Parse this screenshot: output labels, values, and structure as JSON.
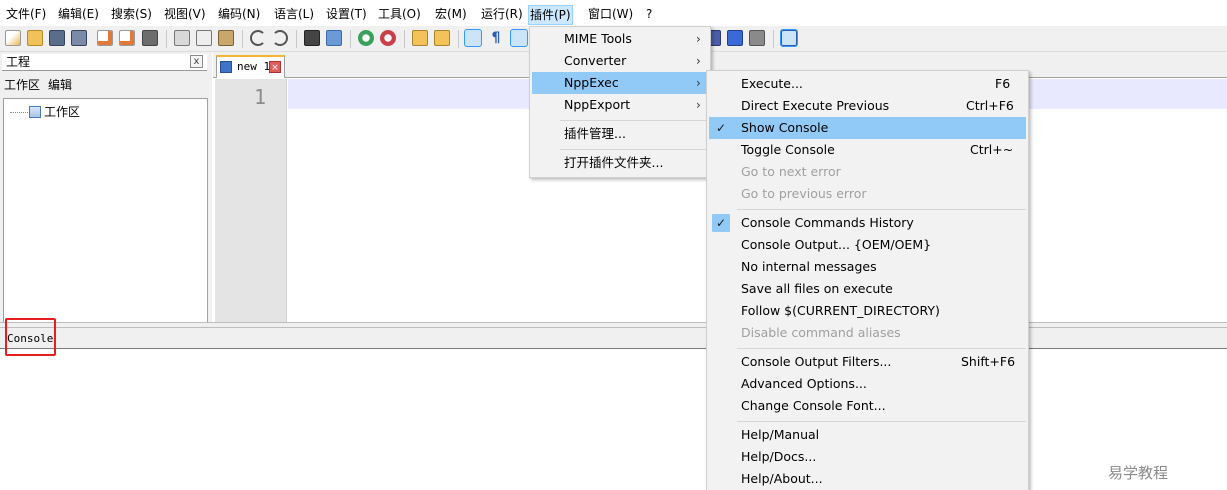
{
  "menubar": {
    "items": [
      "文件(F)",
      "编辑(E)",
      "搜索(S)",
      "视图(V)",
      "编码(N)",
      "语言(L)",
      "设置(T)",
      "工具(O)",
      "宏(M)",
      "运行(R)",
      "插件(P)",
      "窗口(W)",
      "?"
    ],
    "active": "插件(P)"
  },
  "project_panel": {
    "title": "工程",
    "close_glyph": "x",
    "menu": [
      "工作区",
      "编辑"
    ],
    "tree_item": "工作区"
  },
  "editor": {
    "tab_label": "new 1",
    "line_number": "1"
  },
  "console": {
    "label": "Console"
  },
  "plugins_menu": {
    "items": [
      {
        "label": "MIME Tools",
        "submenu": true
      },
      {
        "label": "Converter",
        "submenu": true
      },
      {
        "label": "NppExec",
        "submenu": true,
        "highlighted": true
      },
      {
        "label": "NppExport",
        "submenu": true
      },
      {
        "label": "插件管理..."
      },
      {
        "label": "打开插件文件夹..."
      }
    ],
    "arrow_glyph": "›"
  },
  "nppexec_menu": {
    "groups": [
      [
        {
          "label": "Execute...",
          "shortcut": "F6"
        },
        {
          "label": "Direct Execute Previous",
          "shortcut": "Ctrl+F6"
        },
        {
          "label": "Show Console",
          "checked": true,
          "highlighted": true
        },
        {
          "label": "Toggle Console",
          "shortcut": "Ctrl+~"
        },
        {
          "label": "Go to next error",
          "disabled": true
        },
        {
          "label": "Go to previous error",
          "disabled": true
        }
      ],
      [
        {
          "label": "Console Commands History",
          "checked": true
        },
        {
          "label": "Console Output... {OEM/OEM}"
        },
        {
          "label": "No internal messages"
        },
        {
          "label": "Save all files on execute"
        },
        {
          "label": "Follow $(CURRENT_DIRECTORY)"
        },
        {
          "label": "Disable command aliases",
          "disabled": true
        }
      ],
      [
        {
          "label": "Console Output Filters...",
          "shortcut": "Shift+F6"
        },
        {
          "label": "Advanced Options..."
        },
        {
          "label": "Change Console Font..."
        }
      ],
      [
        {
          "label": "Help/Manual"
        },
        {
          "label": "Help/Docs..."
        },
        {
          "label": "Help/About..."
        }
      ]
    ],
    "check_glyph": "✓"
  },
  "watermark": "易学教程",
  "colors": {
    "menu_highlight": "#91c9f7",
    "active_menubar": "#cce8ff",
    "current_line": "#e8e8ff",
    "annotation_red": "#e81e1e"
  }
}
